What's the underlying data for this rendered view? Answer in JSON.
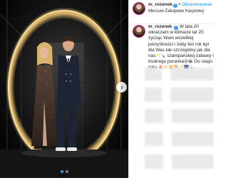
{
  "header": {
    "username": "m_rozenek",
    "separator": "•",
    "follow_label": "Obserwowanie",
    "location": "Mercure Zakopane Kasprowy"
  },
  "caption": {
    "username": "m_rozenek",
    "line1": "W lata 20 wkraczam",
    "line2": "w klimacie lat 20, życząc Wam",
    "line3": "wszelkiej pomyślności i żeby ten rok",
    "line4": "był dla Was tak szczególny jak dla",
    "line5": "nas",
    "line6": "szampańskiej zabawy i",
    "line7": "trudnego poranka",
    "line8": "Do siego",
    "line9": "roku",
    "emojis_a": "🥂🍾",
    "emojis_b": "😜😂",
    "emojis_c": "🎉✨💥🎊🥂🎆🍾"
  },
  "carousel": {
    "next_symbol": "›",
    "slides": 2,
    "active_index": 0
  },
  "colors": {
    "accent": "#0095f6",
    "verified": "#3897f0",
    "text": "#262626"
  },
  "icons": [
    "verified-badge-icon",
    "chevron-right-icon"
  ]
}
